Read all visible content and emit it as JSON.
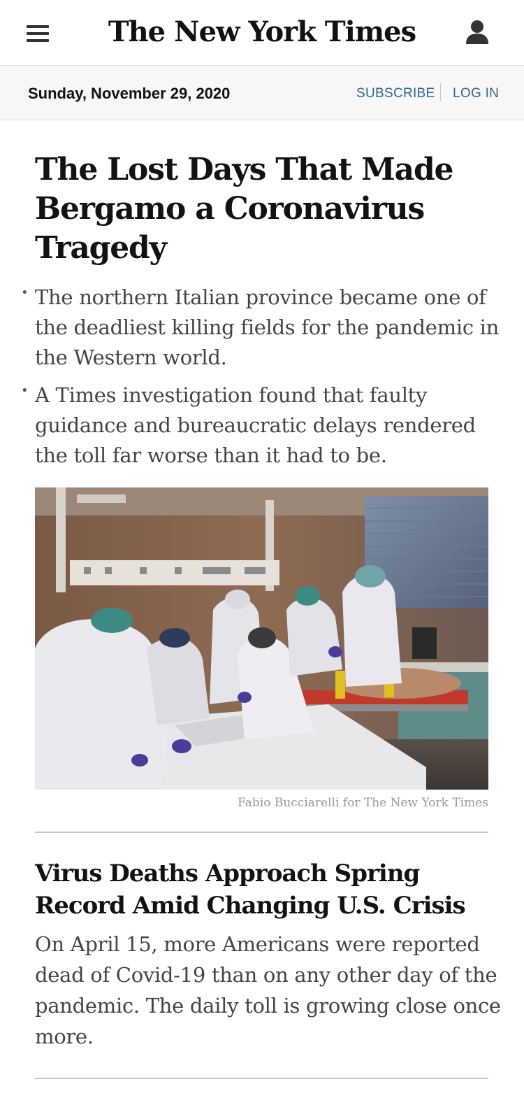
{
  "header": {
    "logo": "The New York Times",
    "menu_icon": "hamburger-menu-icon",
    "account_icon": "user-account-icon"
  },
  "datebar": {
    "date": "Sunday, November 29, 2020",
    "subscribe_label": "SUBSCRIBE",
    "login_label": "LOG IN"
  },
  "lead_story": {
    "headline": "The Lost Days That Made Bergamo a Coronavirus Tragedy",
    "bullets": [
      "The northern Italian province became one of the deadliest killing fields for the pandemic in the Western world.",
      "A Times investigation found that faulty guidance and bureaucratic delays rendered the toll far worse than it had to be."
    ],
    "image_credit": "Fabio Bucciarelli for The New York Times"
  },
  "story_2": {
    "headline": "Virus Deaths Approach Spring Record Amid Changing U.S. Crisis",
    "summary": "On April 15, more Americans were reported dead of Covid-19 than on any other day of the pandemic. The daily toll is growing close once more."
  },
  "colors": {
    "link": "#326891",
    "text": "#121212",
    "summary_text": "#444444",
    "datebar_bg": "#f7f7f7"
  }
}
